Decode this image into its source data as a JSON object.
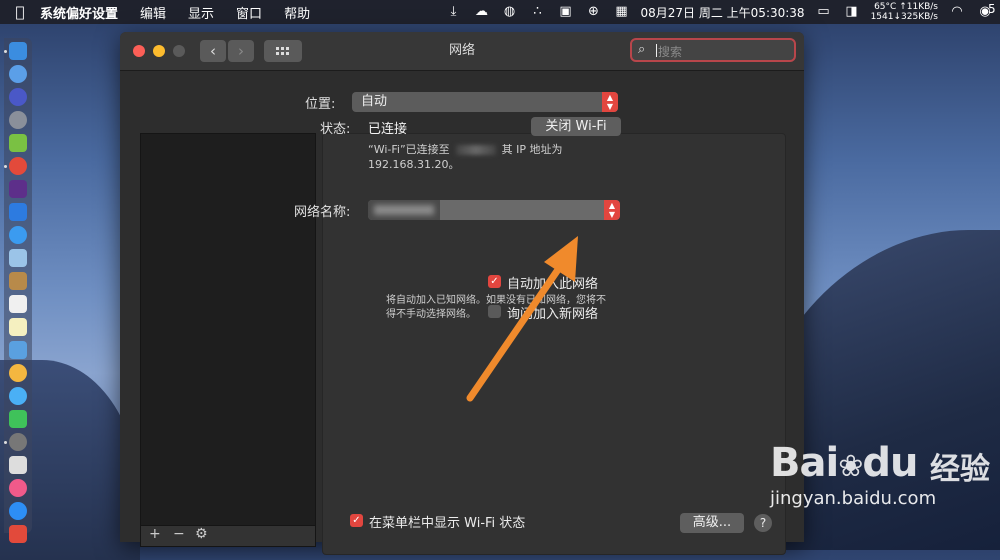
{
  "menubar": {
    "app_name": "系统偏好设置",
    "items": [
      "编辑",
      "显示",
      "窗口",
      "帮助"
    ],
    "datetime": "08月27日 周二 上午05:30:38",
    "temp": "65°C",
    "net_up": "↑11KB/s",
    "net_stats": "1541↓325KB/s"
  },
  "window": {
    "title": "网络",
    "search_placeholder": "搜索"
  },
  "location": {
    "label": "位置:",
    "value": "自动"
  },
  "status": {
    "label": "状态:",
    "value": "已连接",
    "wifi_button": "关闭 Wi-Fi",
    "desc_line1_a": "“Wi-Fi”已连接至",
    "desc_line1_b": "其 IP 地址为",
    "desc_line2": "192.168.31.20。"
  },
  "network_name": {
    "label": "网络名称:"
  },
  "options": {
    "auto_join": "自动加入此网络",
    "auto_join_checked": true,
    "ask_join": "询问加入新网络",
    "ask_join_checked": false,
    "hint_line1": "将自动加入已知网络。如果没有已知网络，您将不",
    "hint_line2": "得不手动选择网络。",
    "show_menubar": "在菜单栏中显示 Wi-Fi 状态",
    "show_menubar_checked": true
  },
  "buttons": {
    "advanced": "高级...",
    "help": "?"
  },
  "list_buttons": {
    "add": "+",
    "remove": "−",
    "gear": "⚙"
  },
  "watermark": {
    "logo": "Bai",
    "logo2": "du",
    "cn": "经验",
    "url": "jingyan.baidu.com"
  },
  "edge_number": "5",
  "colors": {
    "accent": "#e2463f",
    "arrow": "#f08a2c"
  }
}
